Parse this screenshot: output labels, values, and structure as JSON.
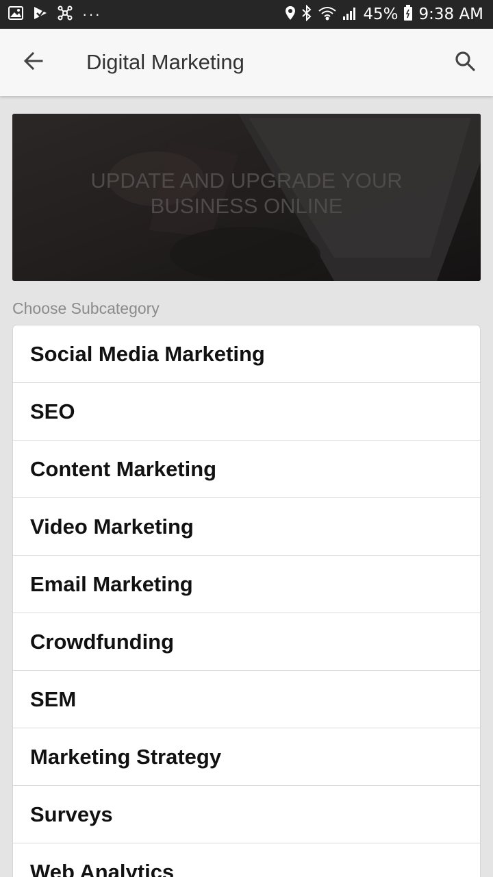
{
  "status_bar": {
    "battery": "45%",
    "time": "9:38 AM",
    "icons_left": [
      "gallery-icon",
      "check-icon",
      "network-icon",
      "more-dots-icon"
    ],
    "icons_right": [
      "location-icon",
      "bluetooth-icon",
      "wifi-icon",
      "signal-icon",
      "battery-icon"
    ]
  },
  "app_bar": {
    "title": "Digital Marketing",
    "back_icon": "arrow-back-icon",
    "search_icon": "search-icon"
  },
  "banner": {
    "text": "UPDATE AND UPGRADE YOUR BUSINESS ONLINE"
  },
  "section": {
    "label": "Choose Subcategory"
  },
  "subcategories": [
    {
      "label": "Social Media Marketing"
    },
    {
      "label": "SEO"
    },
    {
      "label": "Content Marketing"
    },
    {
      "label": "Video Marketing"
    },
    {
      "label": "Email Marketing"
    },
    {
      "label": "Crowdfunding"
    },
    {
      "label": "SEM"
    },
    {
      "label": "Marketing Strategy"
    },
    {
      "label": "Surveys"
    },
    {
      "label": "Web Analytics"
    }
  ]
}
